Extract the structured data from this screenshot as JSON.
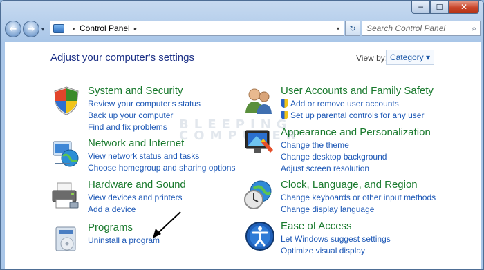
{
  "window": {
    "minimize": "─",
    "maximize": "☐",
    "close": "✕"
  },
  "nav": {
    "back": "←",
    "forward": "→",
    "history": "▾",
    "path_sep": "▸",
    "location": "Control Panel",
    "refresh": "↻",
    "search_placeholder": "Search Control Panel",
    "search_glyph": "⌕"
  },
  "main": {
    "heading": "Adjust your computer's settings",
    "view_by_label": "View by:",
    "view_by_value": "Category ▾",
    "watermark_1": "BLEEPING",
    "watermark_2": "COMPUTER"
  },
  "categories": [
    {
      "title": "System and Security",
      "links": [
        "Review your computer's status",
        "Back up your computer",
        "Find and fix problems"
      ]
    },
    {
      "title": "Network and Internet",
      "links": [
        "View network status and tasks",
        "Choose homegroup and sharing options"
      ]
    },
    {
      "title": "Hardware and Sound",
      "links": [
        "View devices and printers",
        "Add a device"
      ]
    },
    {
      "title": "Programs",
      "links": [
        "Uninstall a program"
      ]
    },
    {
      "title": "User Accounts and Family Safety",
      "links": [
        "Add or remove user accounts",
        "Set up parental controls for any user"
      ]
    },
    {
      "title": "Appearance and Personalization",
      "links": [
        "Change the theme",
        "Change desktop background",
        "Adjust screen resolution"
      ]
    },
    {
      "title": "Clock, Language, and Region",
      "links": [
        "Change keyboards or other input methods",
        "Change display language"
      ]
    },
    {
      "title": "Ease of Access",
      "links": [
        "Let Windows suggest settings",
        "Optimize visual display"
      ]
    }
  ]
}
